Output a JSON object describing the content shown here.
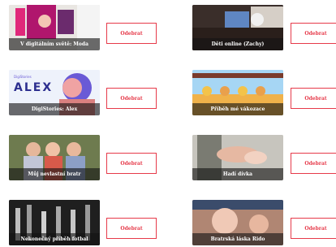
{
  "items": [
    {
      "title": "V digitálním světě: Moda",
      "button": "Odebrat"
    },
    {
      "title": "Děti online (Zachy)",
      "button": "Odebrat"
    },
    {
      "title": "DigiStories: Alex",
      "button": "Odebrat"
    },
    {
      "title": "Příběh mé vákozace",
      "button": "Odebrat"
    },
    {
      "title": "Můj nevlastní bratr",
      "button": "Odebrat"
    },
    {
      "title": "Hadí dívka",
      "button": "Odebrat"
    },
    {
      "title": "Nekonečný příběh fotbal",
      "button": "Odebrat"
    },
    {
      "title": "Bratrská láska Rido",
      "button": "Odebrat"
    }
  ],
  "thumb2_logo": "DigiStories",
  "thumb2_word": "ALEX",
  "colors": {
    "accent": "#e63a4a"
  }
}
